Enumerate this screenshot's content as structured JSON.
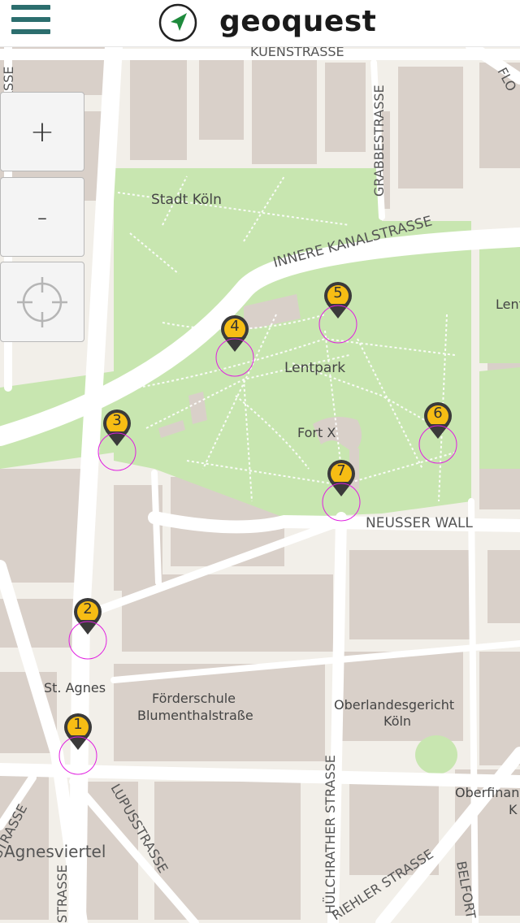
{
  "app": {
    "title": "geoquest",
    "menu_icon": "hamburger-menu-icon",
    "logo_icon": "navigation-arrow-icon"
  },
  "controls": {
    "zoom_in_label": "+",
    "zoom_out_label": "-",
    "locate_icon": "crosshair-icon"
  },
  "map": {
    "labels": {
      "kuenstrasse": "KUENSTRASSE",
      "stadt_koeln": "Stadt Köln",
      "grabbestrasse": "GRABBESTRASSE",
      "flo": "FLO",
      "innere_kanalstrasse": "INNERE KANALSTRASSE",
      "lent": "Lent",
      "lentpark": "Lentpark",
      "fort_x": "Fort X",
      "neusser_wall": "NEUSSER WALL",
      "st_agnes": "St. Agnes",
      "foerderschule_1": "Förderschule",
      "foerderschule_2": "Blumenthalstraße",
      "oberlandesgericht_1": "Oberlandesgericht",
      "oberlandesgericht_2": "Köln",
      "oberfinan": "Oberfinan",
      "k_label": "K",
      "agnesviertel": "Agnesviertel",
      "lupusstrasse": "LUPUSSTRASSE",
      "huelchrather": "HÜLCHRATHER STRASSE",
      "riehler": "RIEHLER STRASSE",
      "belfort": "BELFORT",
      "strasse_left": "STRASSE",
      "strasse_bottom": "STRASSE",
      "asse_top": "ASSE"
    },
    "colors": {
      "background": "#f2efe9",
      "park": "#c8e6b0",
      "building": "#d9d0c9",
      "road": "#ffffff",
      "marker_fill": "#f7bd14",
      "marker_body": "#3a3a3a",
      "circle": "#e020e0",
      "accent": "#2c6e6e"
    }
  },
  "markers": [
    {
      "number": "1"
    },
    {
      "number": "2"
    },
    {
      "number": "3"
    },
    {
      "number": "4"
    },
    {
      "number": "5"
    },
    {
      "number": "6"
    },
    {
      "number": "7"
    }
  ]
}
